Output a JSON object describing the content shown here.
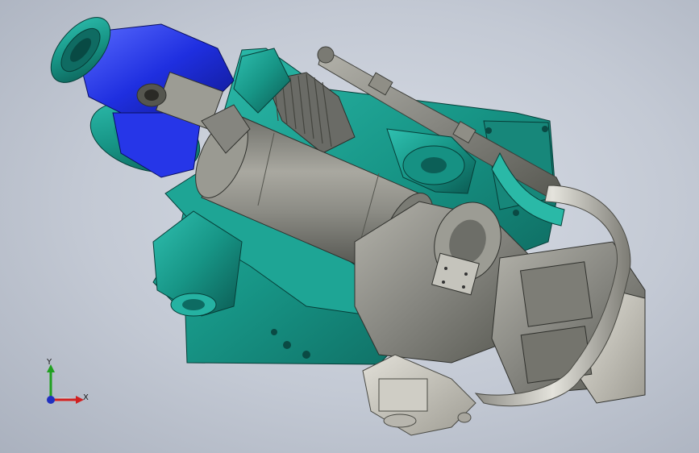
{
  "viewport": {
    "background_top": "#d8dde6",
    "background_bottom": "#aab1be"
  },
  "triad": {
    "x_label": "X",
    "y_label": "Y",
    "x_color": "#d02020",
    "y_color": "#20a020",
    "z_color": "#2030c0"
  },
  "palette": {
    "teal": "#1a9a8c",
    "teal_dark": "#0c5f57",
    "blue": "#1f2fe0",
    "gray_body": "#8a8b86",
    "gray_light": "#c9c7bf",
    "metal": "#b8b7ae"
  }
}
